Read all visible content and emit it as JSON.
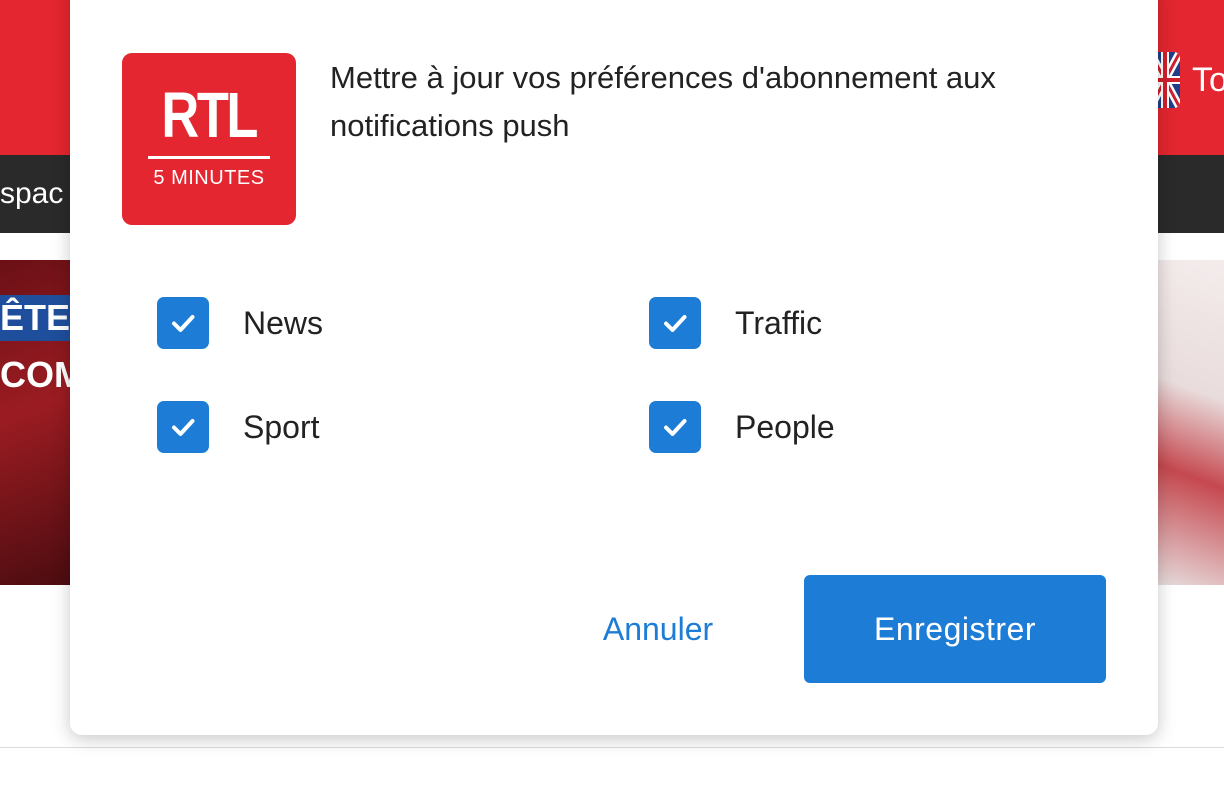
{
  "background": {
    "nav_text": "spac",
    "lang_text": "To",
    "caption_line1": "ÊTES",
    "caption_line2": "COM"
  },
  "dialog": {
    "logo_text": "RTL",
    "logo_subtext": "5 MINUTES",
    "title": "Mettre à jour vos préférences d'abonnement aux notifications push",
    "options": [
      {
        "label": "News",
        "checked": true
      },
      {
        "label": "Traffic",
        "checked": true
      },
      {
        "label": "Sport",
        "checked": true
      },
      {
        "label": "People",
        "checked": true
      }
    ],
    "cancel_label": "Annuler",
    "save_label": "Enregistrer"
  },
  "colors": {
    "brand_red": "#e3262f",
    "accent_blue": "#1c7cd6"
  }
}
